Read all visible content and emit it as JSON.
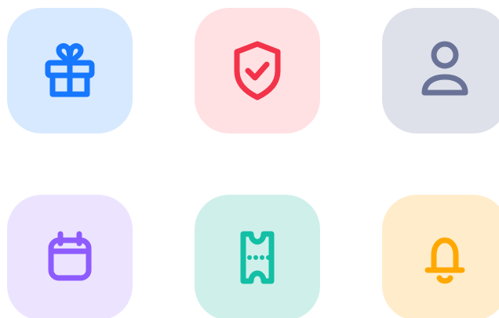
{
  "tiles": [
    {
      "icon": "gift-icon",
      "background": "#D7E9FF",
      "color": "#1677FF"
    },
    {
      "icon": "shield-check-icon",
      "background": "#FFE1E3",
      "color": "#F2334A"
    },
    {
      "icon": "user-icon",
      "background": "#DEE1EA",
      "color": "#6A7397"
    },
    {
      "icon": "calendar-icon",
      "background": "#ECE4FF",
      "color": "#8E5BFF"
    },
    {
      "icon": "ticket-icon",
      "background": "#CFF0EA",
      "color": "#13BFA5"
    },
    {
      "icon": "bell-icon",
      "background": "#FFECCB",
      "color": "#FFA800"
    }
  ]
}
